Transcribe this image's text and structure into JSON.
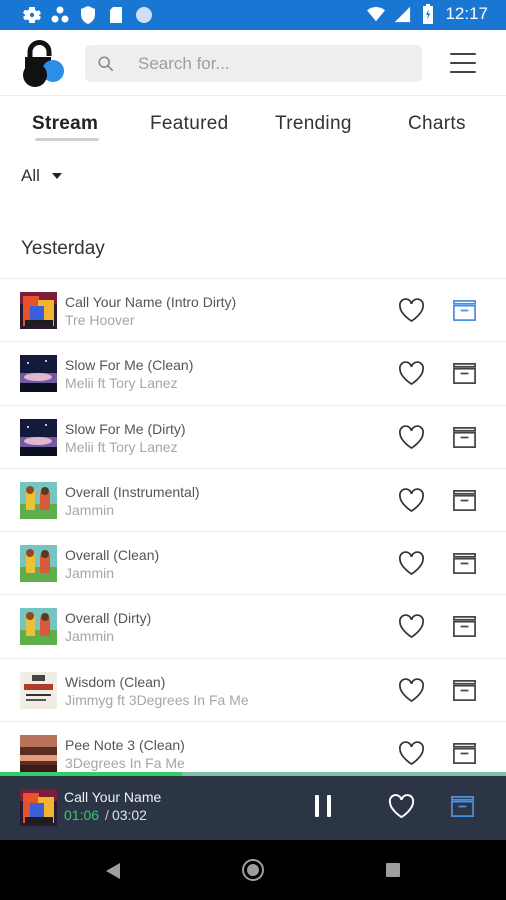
{
  "status_bar": {
    "time": "12:17"
  },
  "header": {
    "search_placeholder": "Search for..."
  },
  "tabs": [
    {
      "label": "Stream",
      "active": true
    },
    {
      "label": "Featured",
      "active": false
    },
    {
      "label": "Trending",
      "active": false
    },
    {
      "label": "Charts",
      "active": false
    }
  ],
  "filter": {
    "selected": "All"
  },
  "section": {
    "title": "Yesterday"
  },
  "tracks": [
    {
      "title": "Call Your Name  (Intro Dirty)",
      "artist": "Tre Hoover",
      "art": "red-orange",
      "crate_active": true
    },
    {
      "title": "Slow For Me  (Clean)",
      "artist": "Melii ft Tory Lanez",
      "art": "night-sky",
      "crate_active": false
    },
    {
      "title": "Slow For Me  (Dirty)",
      "artist": "Melii ft Tory Lanez",
      "art": "night-sky",
      "crate_active": false
    },
    {
      "title": "Overall  (Instrumental)",
      "artist": "Jammin",
      "art": "colorful-cartoon",
      "crate_active": false
    },
    {
      "title": "Overall  (Clean)",
      "artist": "Jammin",
      "art": "colorful-cartoon",
      "crate_active": false
    },
    {
      "title": "Overall  (Dirty)",
      "artist": "Jammin",
      "art": "colorful-cartoon",
      "crate_active": false
    },
    {
      "title": "Wisdom  (Clean)",
      "artist": "Jimmyg ft 3Degrees In Fa Me",
      "art": "white-poster",
      "crate_active": false
    },
    {
      "title": "Pee Note 3  (Clean)",
      "artist": "3Degrees In Fa Me",
      "art": "brown-red",
      "crate_active": false
    }
  ],
  "player": {
    "title": "Call Your Name",
    "elapsed": "01:06",
    "separator": "/",
    "duration": "03:02",
    "progress": 0.36,
    "state": "playing"
  },
  "colors": {
    "status_bar": "#1976d2",
    "accent_blue": "#4a90e2",
    "progress_green": "#33cc66",
    "player_bg": "#2b3546"
  },
  "icons": {
    "status_left": [
      "gear-icon",
      "sync-icon",
      "shield-icon",
      "sd-card-icon",
      "circle-icon"
    ],
    "status_right": [
      "wifi-icon",
      "signal-icon",
      "battery-icon"
    ],
    "row_actions": [
      "heart-icon",
      "crate-icon"
    ],
    "nav": [
      "back-icon",
      "home-icon",
      "recents-icon"
    ]
  }
}
